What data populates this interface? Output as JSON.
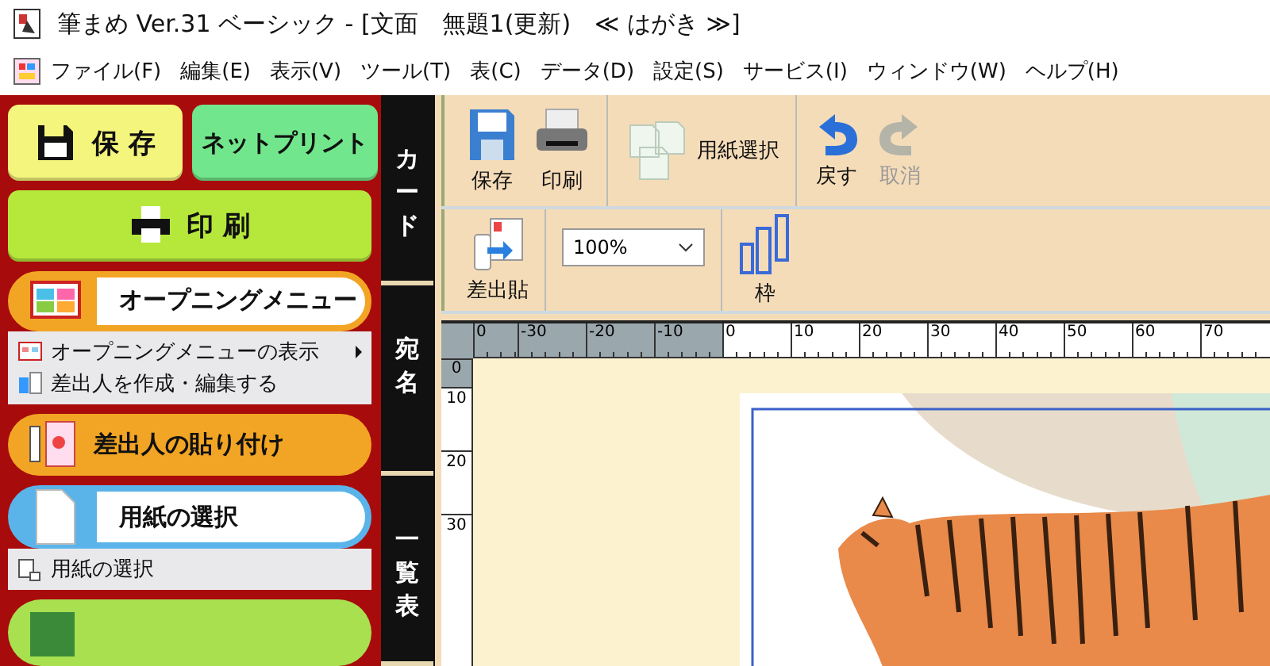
{
  "window": {
    "title": "筆まめ Ver.31 ベーシック - [文面　無題1(更新)　≪ はがき ≫]"
  },
  "menu": [
    "ファイル(F)",
    "編集(E)",
    "表示(V)",
    "ツール(T)",
    "表(C)",
    "データ(D)",
    "設定(S)",
    "サービス(I)",
    "ウィンドウ(W)",
    "ヘルプ(H)"
  ],
  "side_panel": {
    "buttons": [
      {
        "kind": "save",
        "label": "保 存"
      },
      {
        "kind": "netprint",
        "label": "ネットプリント"
      },
      {
        "kind": "print",
        "label": "印 刷"
      }
    ],
    "sections": [
      {
        "kind": "opening",
        "label": "オープニングメニュー",
        "color": "#f2a524",
        "items": [
          {
            "kind": "opening-view",
            "label": "オープニングメニューの表示",
            "submenu": true
          },
          {
            "kind": "sender-edit",
            "label": "差出人を作成・編集する",
            "submenu": false
          }
        ]
      },
      {
        "kind": "sender",
        "label": "差出人の貼り付け",
        "color": "#f2a524"
      },
      {
        "kind": "paper",
        "label": "用紙の選択",
        "color": "#5ab4ea",
        "items": [
          {
            "kind": "paper-select",
            "label": "用紙の選択",
            "submenu": false
          }
        ]
      },
      {
        "kind": "text",
        "color": "#a8e050"
      }
    ]
  },
  "tabs": [
    {
      "label": "カード"
    },
    {
      "label": "宛名"
    },
    {
      "label": "一覧表"
    }
  ],
  "toolbar": {
    "rows": [
      {
        "groups": [
          {
            "tools": [
              {
                "kind": "save",
                "label": "保存",
                "disabled": false
              },
              {
                "kind": "print",
                "label": "印刷",
                "disabled": false
              }
            ]
          },
          {
            "tools": [
              {
                "kind": "paper",
                "label": "用紙選択",
                "disabled": false
              }
            ]
          },
          {
            "tools": [
              {
                "kind": "undo",
                "label": "戻す",
                "disabled": false
              },
              {
                "kind": "redo",
                "label": "取消",
                "disabled": true
              }
            ]
          }
        ]
      },
      {
        "groups": [
          {
            "tools": [
              {
                "kind": "sender",
                "label": "差出貼",
                "disabled": false
              }
            ]
          },
          {
            "tools": [
              {
                "kind": "zoom",
                "label": "100%"
              }
            ]
          },
          {
            "tools": [
              {
                "kind": "frame",
                "label": "枠",
                "disabled": false
              }
            ]
          }
        ]
      }
    ]
  },
  "ruler": {
    "h_labels": [
      "0",
      "-30",
      "-20",
      "-10",
      "0",
      "10",
      "20",
      "30",
      "40",
      "50",
      "60",
      "70"
    ],
    "v_labels": [
      "0",
      "10",
      "20",
      "30"
    ]
  }
}
